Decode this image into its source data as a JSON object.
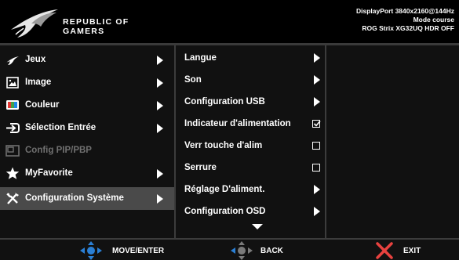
{
  "brand": {
    "line1": "REPUBLIC OF",
    "line2": "GAMERS"
  },
  "status": {
    "line1": "DisplayPort 3840x2160@144Hz",
    "line2": "Mode course",
    "line3": "ROG Strix XG32UQ HDR OFF"
  },
  "main_menu": [
    {
      "label": "Jeux",
      "icon": "gamepad-icon"
    },
    {
      "label": "Image",
      "icon": "picture-icon"
    },
    {
      "label": "Couleur",
      "icon": "color-icon"
    },
    {
      "label": "Sélection Entrée",
      "icon": "input-icon"
    },
    {
      "label": "Config PIP/PBP",
      "icon": "pip-icon",
      "disabled": true
    },
    {
      "label": "MyFavorite",
      "icon": "star-icon"
    },
    {
      "label": "Configuration Système",
      "icon": "wrench-screwdriver-icon",
      "selected": true
    }
  ],
  "sub_menu": [
    {
      "label": "Langue",
      "control": "arrow"
    },
    {
      "label": "Son",
      "control": "arrow"
    },
    {
      "label": "Configuration USB",
      "control": "arrow"
    },
    {
      "label": "Indicateur d'alimentation",
      "control": "checkbox",
      "checked": true
    },
    {
      "label": "Verr touche d'alim",
      "control": "checkbox",
      "checked": false
    },
    {
      "label": "Serrure",
      "control": "checkbox",
      "checked": false
    },
    {
      "label": "Réglage D'aliment.",
      "control": "arrow"
    },
    {
      "label": "Configuration OSD",
      "control": "arrow"
    }
  ],
  "footer": {
    "move": "MOVE/ENTER",
    "back": "BACK",
    "exit": "EXIT"
  },
  "colors": {
    "background": "#111111",
    "selected": "#4a4a4a",
    "joystick_blue": "#2a7fd4",
    "exit_red": "#e8423f",
    "disabled_text": "#707070"
  }
}
